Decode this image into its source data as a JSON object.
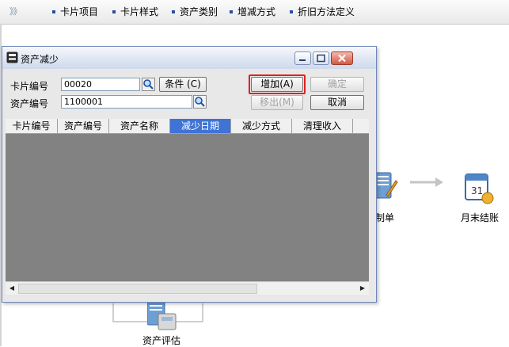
{
  "toolbar": {
    "arrow": "》》",
    "items": [
      "卡片项目",
      "卡片样式",
      "资产类别",
      "增减方式",
      "折旧方法定义"
    ]
  },
  "background": {
    "voucher_label": "制单",
    "month_end_label": "月末结账",
    "assessment_label": "资产评估"
  },
  "dialog": {
    "title": "资产减少",
    "card_no_label": "卡片编号",
    "card_no_value": "00020",
    "asset_no_label": "资产编号",
    "asset_no_value": "1100001",
    "condition_button": "条件 (C)",
    "add_button": "增加(A)",
    "confirm_button": "确定",
    "move_out_button": "移出(M)",
    "cancel_button": "取消",
    "columns": [
      "卡片编号",
      "资产编号",
      "资产名称",
      "减少日期",
      "减少方式",
      "清理收入"
    ],
    "active_column": "减少日期"
  },
  "colors": {
    "highlight": "#e02020",
    "active_header": "#3f73d6",
    "grid_background": "#828282"
  }
}
